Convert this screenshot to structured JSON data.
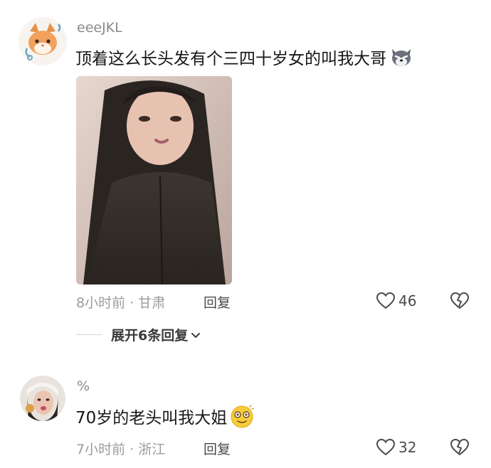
{
  "comments": [
    {
      "username": "eeeJKL",
      "text": "顶着这么长头发有个三四十岁女的叫我大哥",
      "emoji": "wolf-face-emoji",
      "has_photo": true,
      "meta": "8小时前 · 甘肃",
      "reply_label": "回复",
      "like_count": "46",
      "expand_label": "展开6条回复"
    },
    {
      "username": "%",
      "text": "70岁的老头叫我大姐",
      "emoji": "dizzy-face-emoji",
      "has_photo": false,
      "meta": "7小时前 · 浙江",
      "reply_label": "回复",
      "like_count": "32"
    }
  ],
  "icons": {
    "like": "heart-outline-icon",
    "dislike": "broken-heart-icon",
    "expand": "chevron-down-icon"
  },
  "colors": {
    "meta_gray": "#9b9b9f",
    "text": "#161616",
    "emoji_yellow": "#f6cc3a"
  }
}
